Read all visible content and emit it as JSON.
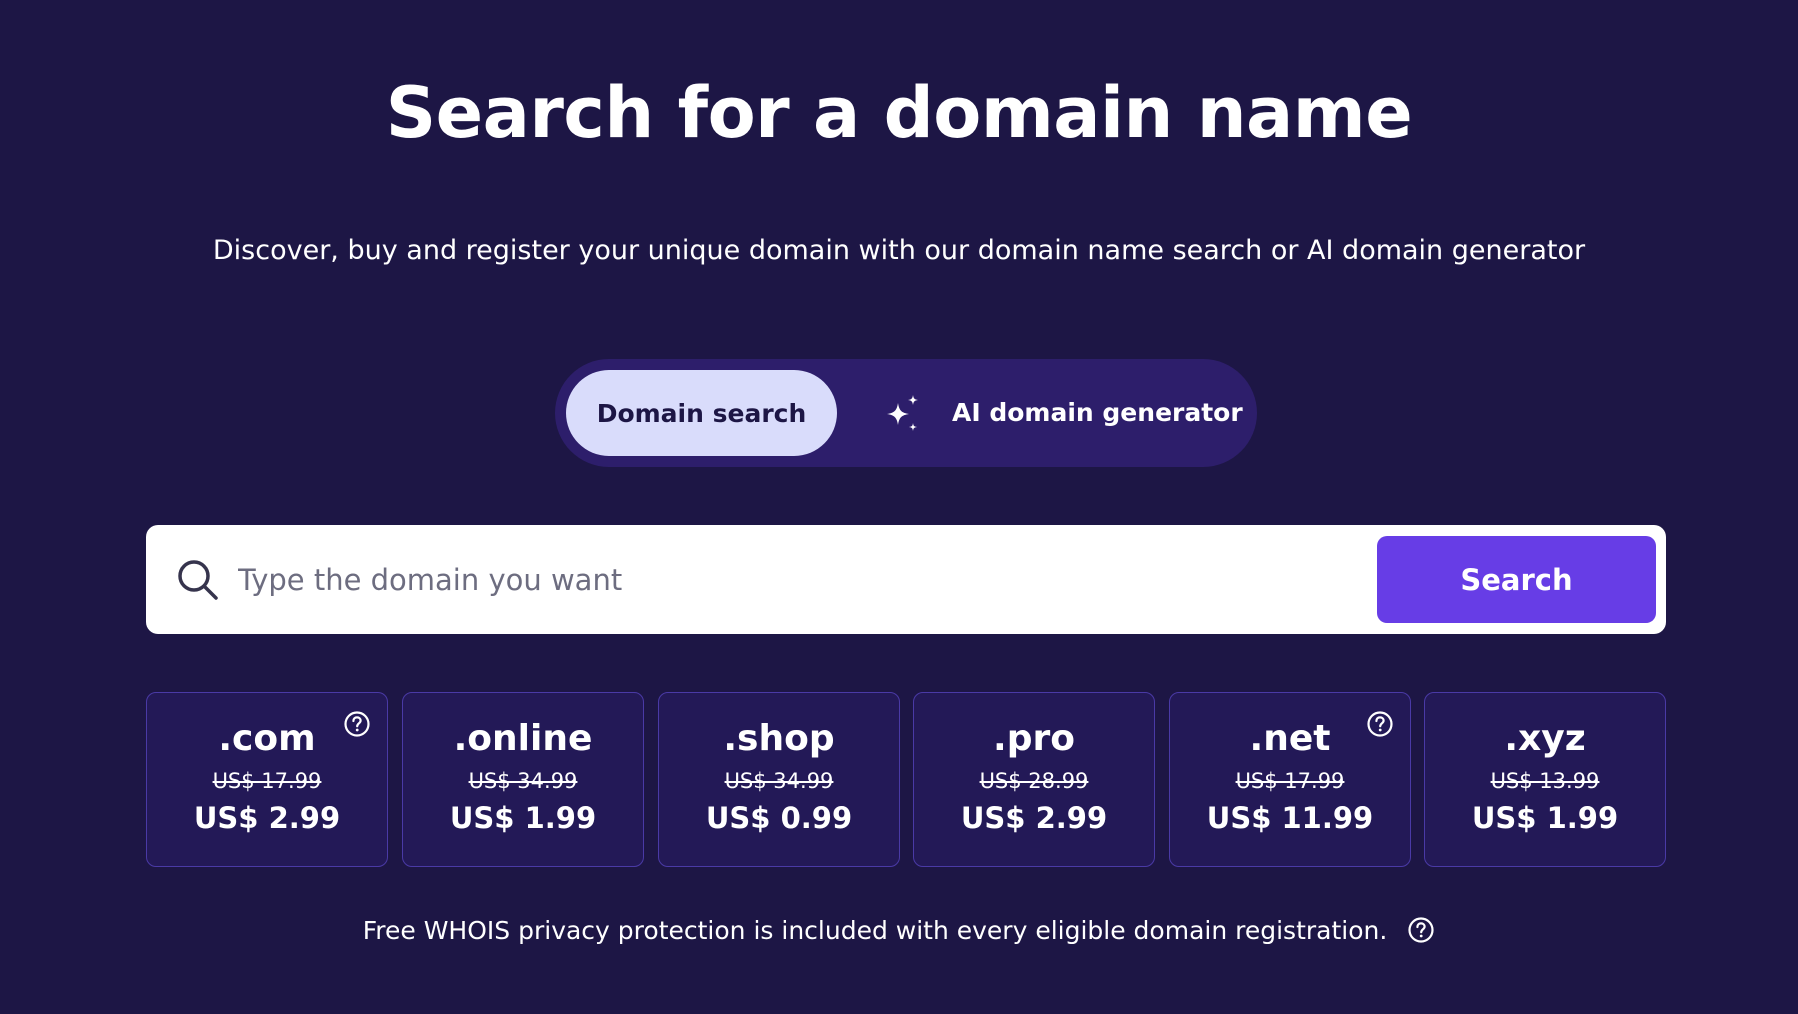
{
  "header": {
    "title": "Search for a domain name",
    "subtitle": "Discover, buy and register your unique domain with our domain name search or AI domain generator"
  },
  "mode_toggle": {
    "domain_search_label": "Domain search",
    "ai_generator_label": "AI domain generator",
    "selected": "Domain search"
  },
  "search": {
    "placeholder": "Type the domain you want",
    "value": "",
    "button_label": "Search"
  },
  "tlds": [
    {
      "name": ".com",
      "old_price": "US$ 17.99",
      "new_price": "US$ 2.99",
      "has_help_icon": true
    },
    {
      "name": ".online",
      "old_price": "US$ 34.99",
      "new_price": "US$ 1.99",
      "has_help_icon": false
    },
    {
      "name": ".shop",
      "old_price": "US$ 34.99",
      "new_price": "US$ 0.99",
      "has_help_icon": false
    },
    {
      "name": ".pro",
      "old_price": "US$ 28.99",
      "new_price": "US$ 2.99",
      "has_help_icon": false
    },
    {
      "name": ".net",
      "old_price": "US$ 17.99",
      "new_price": "US$ 11.99",
      "has_help_icon": true
    },
    {
      "name": ".xyz",
      "old_price": "US$ 13.99",
      "new_price": "US$ 1.99",
      "has_help_icon": false
    }
  ],
  "footer": {
    "note": "Free WHOIS privacy protection is included with every eligible domain registration."
  },
  "colors": {
    "background": "#1d1645",
    "toggle_track": "#2d1e6b",
    "toggle_active": "#d9dcfb",
    "accent": "#673de6",
    "card_bg": "#231957",
    "card_border": "#4a3aa6"
  },
  "icons": {
    "search": "search-icon",
    "sparkle": "sparkle-icon",
    "help": "question-circle-icon"
  }
}
